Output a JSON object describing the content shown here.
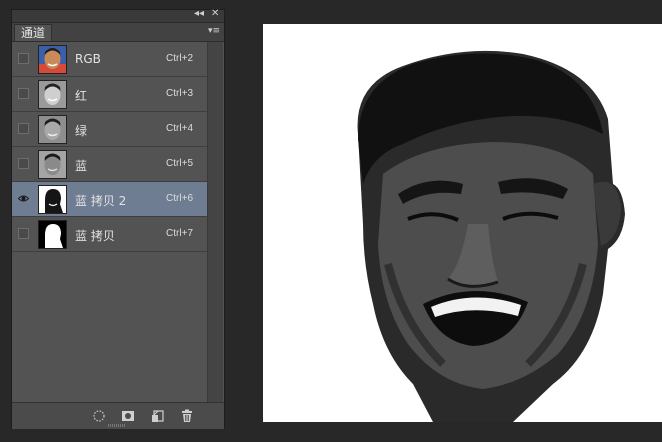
{
  "window": {
    "collapse_glyph": "◂◂",
    "close_glyph": "✕"
  },
  "panel": {
    "tab_label": "通道",
    "menu_glyph": "▾≡",
    "channels": [
      {
        "name": "RGB",
        "shortcut": "Ctrl+2",
        "visible": false,
        "selected": false,
        "thumb": "color-portrait"
      },
      {
        "name": "红",
        "shortcut": "Ctrl+3",
        "visible": false,
        "selected": false,
        "thumb": "gray-portrait"
      },
      {
        "name": "绿",
        "shortcut": "Ctrl+4",
        "visible": false,
        "selected": false,
        "thumb": "gray-portrait"
      },
      {
        "name": "蓝",
        "shortcut": "Ctrl+5",
        "visible": false,
        "selected": false,
        "thumb": "gray-portrait"
      },
      {
        "name": "蓝 拷贝 2",
        "shortcut": "Ctrl+6",
        "visible": true,
        "selected": true,
        "thumb": "dark-mask"
      },
      {
        "name": "蓝 拷贝",
        "shortcut": "Ctrl+7",
        "visible": false,
        "selected": false,
        "thumb": "white-mask"
      }
    ],
    "footer_icons": [
      "load-selection-icon",
      "save-selection-icon",
      "new-channel-icon",
      "delete-channel-icon"
    ]
  },
  "colors": {
    "selected_row": "#6f7d93",
    "panel_bg": "#535353",
    "app_bg": "#282828"
  }
}
